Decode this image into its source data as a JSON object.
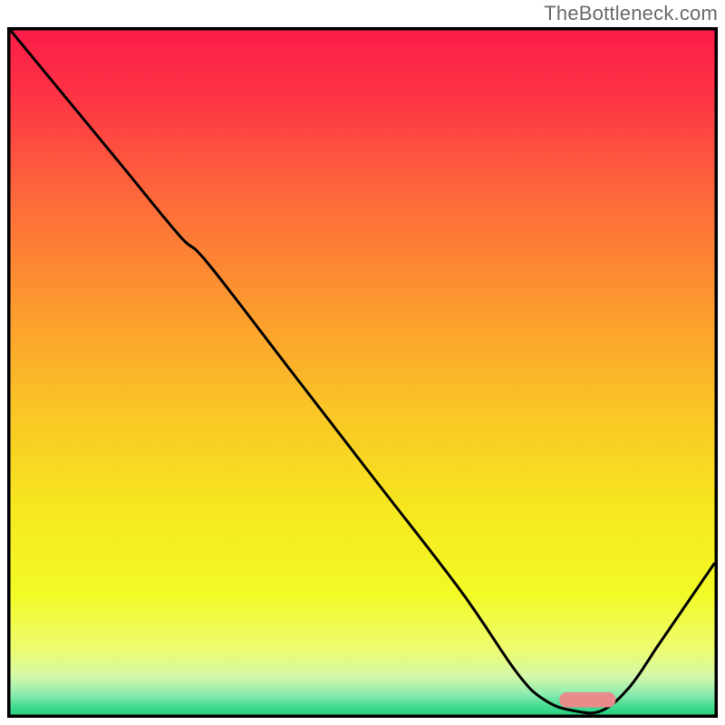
{
  "watermark": "TheBottleneck.com",
  "chart_data": {
    "type": "line",
    "title": "",
    "xlabel": "",
    "ylabel": "",
    "xlim": [
      0,
      100
    ],
    "ylim": [
      0,
      100
    ],
    "grid": false,
    "legend": false,
    "series": [
      {
        "name": "bottleneck-curve",
        "color": "#000000",
        "x": [
          0,
          8,
          16,
          24,
          28,
          40,
          52,
          64,
          72,
          76,
          80,
          84,
          88,
          92,
          96,
          100
        ],
        "y": [
          100,
          90,
          80,
          70,
          66,
          50,
          34,
          18,
          6,
          2,
          0.5,
          0.5,
          4,
          10,
          16,
          22
        ]
      }
    ],
    "optimal_marker": {
      "x_start": 78,
      "x_end": 86,
      "y": 1.0,
      "height": 2.2,
      "color": "#e98b8b"
    },
    "background_gradient": {
      "stops": [
        {
          "offset": 0.0,
          "color": "#fc1b4a"
        },
        {
          "offset": 0.1,
          "color": "#fd3445"
        },
        {
          "offset": 0.25,
          "color": "#fd6a3a"
        },
        {
          "offset": 0.4,
          "color": "#fc982f"
        },
        {
          "offset": 0.55,
          "color": "#fac426"
        },
        {
          "offset": 0.7,
          "color": "#f6e81f"
        },
        {
          "offset": 0.82,
          "color": "#f2fa25"
        },
        {
          "offset": 0.9,
          "color": "#eefc70"
        },
        {
          "offset": 0.94,
          "color": "#d4f8a8"
        },
        {
          "offset": 0.965,
          "color": "#8fecb0"
        },
        {
          "offset": 0.985,
          "color": "#3fd98f"
        },
        {
          "offset": 1.0,
          "color": "#1ecf79"
        }
      ]
    }
  }
}
